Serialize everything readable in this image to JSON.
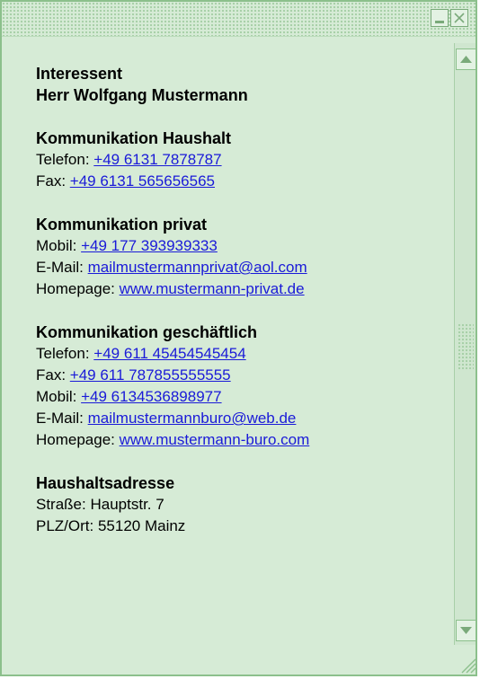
{
  "contact": {
    "role": "Interessent",
    "name": "Herr Wolfgang Mustermann"
  },
  "household": {
    "heading": "Kommunikation Haushalt",
    "phone_label": "Telefon:",
    "phone": "+49 6131 7878787",
    "fax_label": "Fax:",
    "fax": "+49 6131 565656565"
  },
  "private": {
    "heading": "Kommunikation privat",
    "mobile_label": "Mobil:",
    "mobile": "+49 177 393939333",
    "email_label": "E-Mail:",
    "email": "mailmustermannprivat@aol.com",
    "homepage_label": "Homepage:",
    "homepage": "www.mustermann-privat.de"
  },
  "business": {
    "heading": "Kommunikation geschäftlich",
    "phone_label": "Telefon:",
    "phone": "+49 611 45454545454",
    "fax_label": "Fax:",
    "fax": "+49 611 787855555555",
    "mobile_label": "Mobil:",
    "mobile": "+49 6134536898977",
    "email_label": "E-Mail:",
    "email": "mailmustermannburo@web.de",
    "homepage_label": "Homepage:",
    "homepage": "www.mustermann-buro.com"
  },
  "address": {
    "heading": "Haushaltsadresse",
    "street_label": "Straße:",
    "street": "Hauptstr. 7",
    "city_label": "PLZ/Ort:",
    "city": "55120 Mainz"
  },
  "icons": {
    "minimize": "minimize-icon",
    "close": "close-icon",
    "scroll_up": "arrow-up-icon",
    "scroll_down": "arrow-down-icon",
    "resize": "resize-grip-icon"
  },
  "colors": {
    "window_bg": "#d6ebd6",
    "border": "#8cc08c",
    "link": "#1a1ad8"
  }
}
